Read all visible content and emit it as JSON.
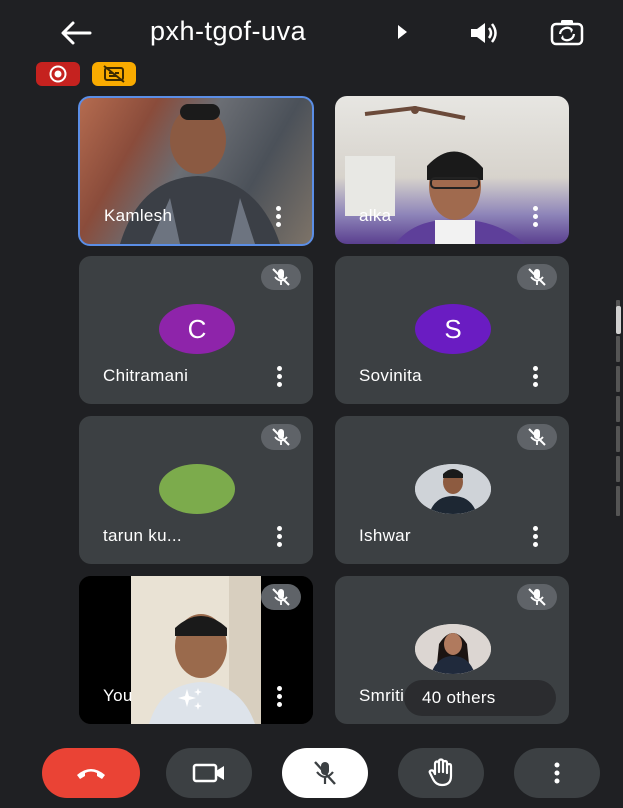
{
  "header": {
    "meeting_code": "pxh-tgof-uva",
    "back_icon": "arrow-left-icon",
    "speaker_icon": "volume-icon",
    "switch_camera_icon": "switch-camera-icon"
  },
  "indicators": [
    {
      "icon": "record-icon",
      "color": "#c5221f"
    },
    {
      "icon": "captions-off-icon",
      "color": "#f9ab00"
    }
  ],
  "tiles": [
    {
      "name": "Kamlesh",
      "type": "video",
      "muted": false,
      "highlighted": true
    },
    {
      "name": "alka",
      "type": "video",
      "muted": false
    },
    {
      "name": "Chitramani",
      "type": "initial",
      "initial": "C",
      "avatar_color": "#8e24aa",
      "muted": true
    },
    {
      "name": "Sovinita",
      "type": "initial",
      "initial": "S",
      "avatar_color": "#6a1cc2",
      "muted": true
    },
    {
      "name": "tarun ku...",
      "type": "photo",
      "avatar_color": "#7cb342",
      "muted": true
    },
    {
      "name": "Ishwar",
      "type": "photo",
      "muted": true
    },
    {
      "name": "You",
      "type": "video",
      "muted": true
    },
    {
      "name": "Smriti",
      "type": "photo",
      "muted": true,
      "overlay": "40 others"
    }
  ],
  "controls": [
    {
      "name": "end-call",
      "icon": "phone-hangup-icon",
      "color": "#ea4335"
    },
    {
      "name": "camera",
      "icon": "video-camera-icon"
    },
    {
      "name": "microphone",
      "icon": "mic-off-icon",
      "color": "#ffffff"
    },
    {
      "name": "raise-hand",
      "icon": "hand-icon"
    },
    {
      "name": "more-options",
      "icon": "more-vert-icon"
    }
  ]
}
